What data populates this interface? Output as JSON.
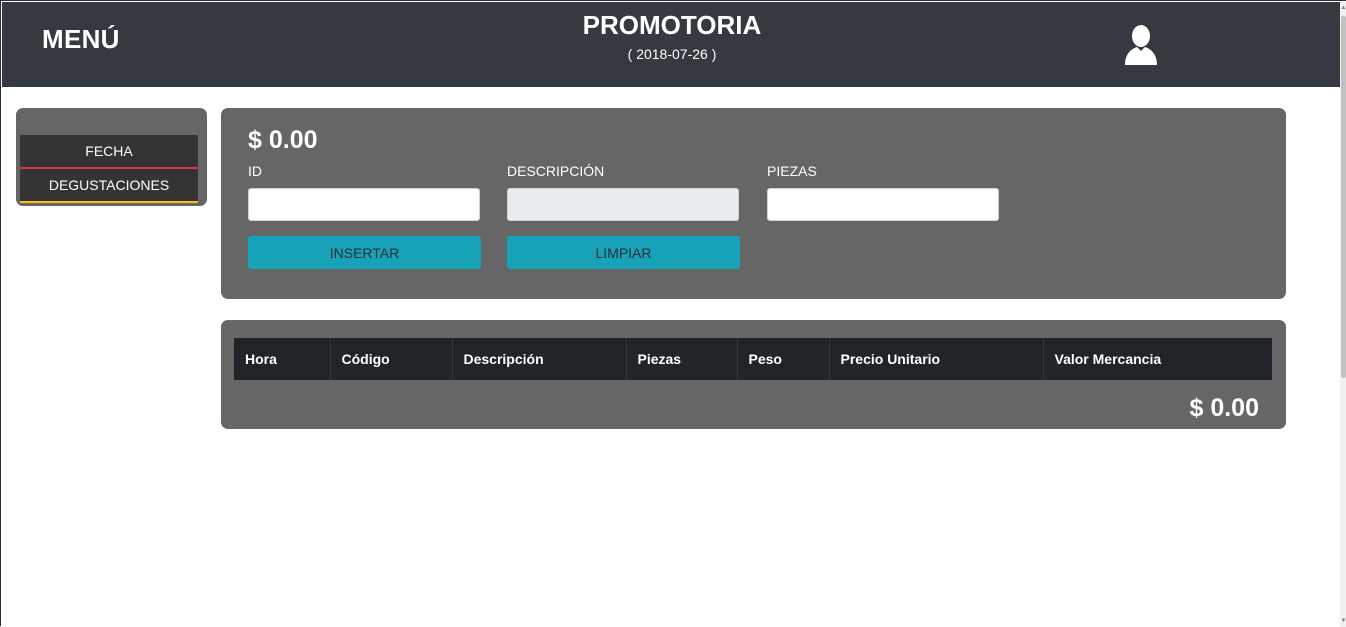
{
  "header": {
    "menu_label": "MENÚ",
    "title": "PROMOTORIA",
    "date": "( 2018-07-26 )",
    "user_icon": "user-icon"
  },
  "sidebar": {
    "items": [
      {
        "label": "FECHA",
        "accent": "#dc3545"
      },
      {
        "label": "DEGUSTACIONES",
        "accent": "#ffc107"
      }
    ]
  },
  "form": {
    "amount": "$ 0.00",
    "fields": [
      {
        "label": "ID",
        "value": "",
        "readonly": false
      },
      {
        "label": "DESCRIPCIÓN",
        "value": "",
        "readonly": true
      },
      {
        "label": "PIEZAS",
        "value": "",
        "readonly": false
      }
    ],
    "buttons": {
      "insert": "INSERTAR",
      "clear": "LIMPIAR"
    },
    "button_color": "#17a2b8"
  },
  "table": {
    "columns": [
      "Hora",
      "Código",
      "Descripción",
      "Piezas",
      "Peso",
      "Precio Unitario",
      "Valor Mercancia"
    ],
    "rows": [],
    "total": "$ 0.00"
  },
  "colors": {
    "header_bg": "#343a40",
    "card_bg": "#666666",
    "table_header_bg": "#212529"
  }
}
